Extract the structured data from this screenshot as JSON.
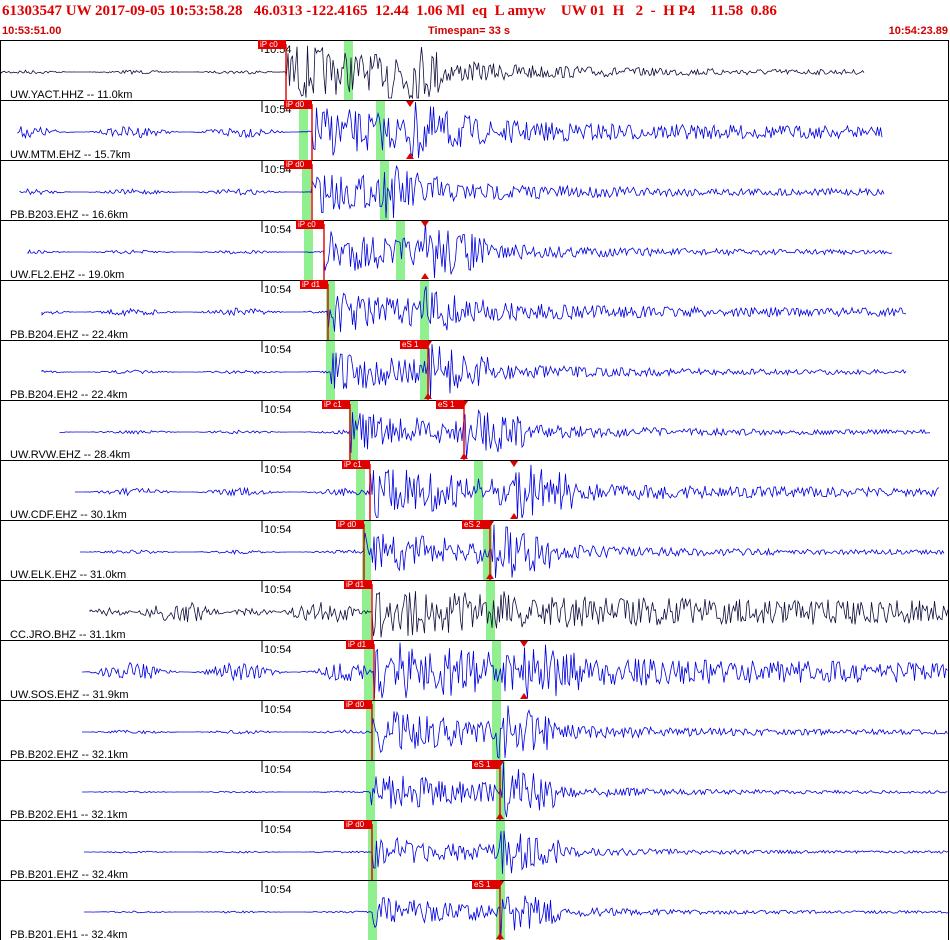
{
  "header": {
    "title": "61303547 UW 2017-09-05 10:53:58.28   46.0313 -122.4165  12.44  1.06 Ml  eq  L amyw    UW 01  H   2  -  H P4    11.58  0.86",
    "start_time": "10:53:51.00",
    "timespan": "Timespan=  33 s",
    "end_time": "10:54:23.89"
  },
  "tick_label": "10:54",
  "colors": {
    "header": "#e00000",
    "trace_blue": "#0000e0",
    "trace_dark": "#101040",
    "pick_box": "#e00000",
    "pick_window": "#90f090",
    "grid": "#000000"
  },
  "channels": [
    {
      "label": "UW.YACT.HHZ -- 11.0km",
      "pick_p": "iP c0",
      "pick_s": "",
      "color": "dark"
    },
    {
      "label": "UW.MTM.EHZ -- 15.7km",
      "pick_p": "iP d0",
      "pick_s": "",
      "color": "blue"
    },
    {
      "label": "PB.B203.EHZ -- 16.6km",
      "pick_p": "iP d0",
      "pick_s": "",
      "color": "blue"
    },
    {
      "label": "UW.FL2.EHZ -- 19.0km",
      "pick_p": "iP c0",
      "pick_s": "",
      "color": "blue"
    },
    {
      "label": "PB.B204.EHZ -- 22.4km",
      "pick_p": "iP d1",
      "pick_s": "",
      "color": "blue"
    },
    {
      "label": "PB.B204.EH2 -- 22.4km",
      "pick_p": "",
      "pick_s": "eS 1",
      "color": "blue"
    },
    {
      "label": "UW.RVW.EHZ -- 28.4km",
      "pick_p": "iP c1",
      "pick_s": "eS 1",
      "color": "blue"
    },
    {
      "label": "UW.CDF.EHZ -- 30.1km",
      "pick_p": "iP c1",
      "pick_s": "",
      "color": "blue"
    },
    {
      "label": "UW.ELK.EHZ -- 31.0km",
      "pick_p": "iP d0",
      "pick_s": "eS 2",
      "color": "blue"
    },
    {
      "label": "CC.JRO.BHZ -- 31.1km",
      "pick_p": "iP d1",
      "pick_s": "",
      "color": "dark"
    },
    {
      "label": "UW.SOS.EHZ -- 31.9km",
      "pick_p": "iP d1",
      "pick_s": "",
      "color": "blue"
    },
    {
      "label": "PB.B202.EHZ -- 32.1km",
      "pick_p": "iP d0",
      "pick_s": "",
      "color": "blue"
    },
    {
      "label": "PB.B202.EH1 -- 32.1km",
      "pick_p": "",
      "pick_s": "eS 1",
      "color": "blue"
    },
    {
      "label": "PB.B201.EHZ -- 32.4km",
      "pick_p": "iP d0",
      "pick_s": "",
      "color": "blue"
    },
    {
      "label": "PB.B201.EH1 -- 32.4km",
      "pick_p": "",
      "pick_s": "eS 1",
      "color": "blue"
    }
  ]
}
